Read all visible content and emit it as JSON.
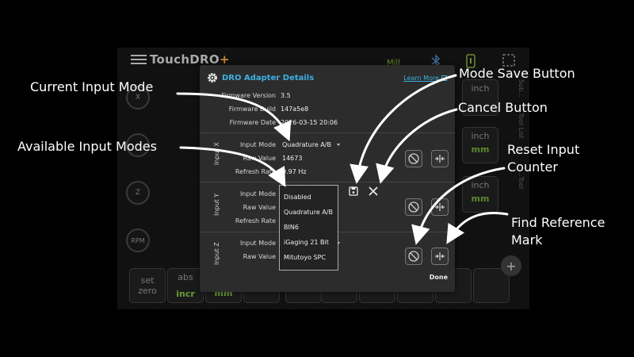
{
  "background": {
    "logo_main": "TouchDRO",
    "logo_accent": "+",
    "mode": "Mill",
    "axes": [
      "X",
      "",
      "Z",
      "RPM"
    ],
    "units": [
      {
        "top": "inch",
        "bottom": "mm"
      },
      {
        "top": "inch",
        "bottom": "mm"
      }
    ],
    "side_text": [
      "Sub...",
      "...Tool List",
      "...Tool"
    ],
    "bottom_buttons": [
      {
        "top": "set",
        "bottom": "zero"
      },
      {
        "top": "abs",
        "bottom": "incr"
      },
      {
        "top": "",
        "bottom": "mm"
      }
    ],
    "plus": "+"
  },
  "dialog": {
    "title": "DRO Adapter Details",
    "learn_more": "Learn More",
    "firmware_version_label": "Firmware Version",
    "firmware_version": "3.5",
    "firmware_build_label": "Firmware Build",
    "firmware_build": "147a5e8",
    "firmware_date_label": "Firmware Date",
    "firmware_date": "2026-03-15 20:06",
    "inputs": [
      {
        "name": "Input X",
        "mode_label": "Input Mode",
        "mode": "Quadrature A/B",
        "raw_label": "Raw Value",
        "raw": "14673",
        "rate_label": "Refresh Rate",
        "rate": "0.97 Hz"
      },
      {
        "name": "Input Y",
        "mode_label": "Input Mode",
        "raw_label": "Raw Value",
        "rate_label": "Refresh Rate"
      },
      {
        "name": "Input Z",
        "mode_label": "Input Mode",
        "raw_label": "Raw Value"
      }
    ],
    "done": "Done"
  },
  "dropdown": {
    "options": [
      "Disabled",
      "Quadrature A/B",
      "BIN6",
      "iGaging 21 Bit",
      "Mitutoyo SPC"
    ]
  },
  "annotations": {
    "current_input_mode": "Current Input Mode",
    "available_input_modes": "Available Input Modes",
    "mode_save_button": "Mode Save Button",
    "cancel_button": "Cancel Button",
    "reset_input_counter_line1": "Reset Input",
    "reset_input_counter_line2": "Counter",
    "find_reference_mark_line1": "Find Reference",
    "find_reference_mark_line2": "Mark"
  },
  "colors": {
    "accent": "#3bb0e0",
    "dialog_bg": "#2c2c2c",
    "brand_accent": "#c98a2c",
    "mm_green": "#5a8a25"
  }
}
